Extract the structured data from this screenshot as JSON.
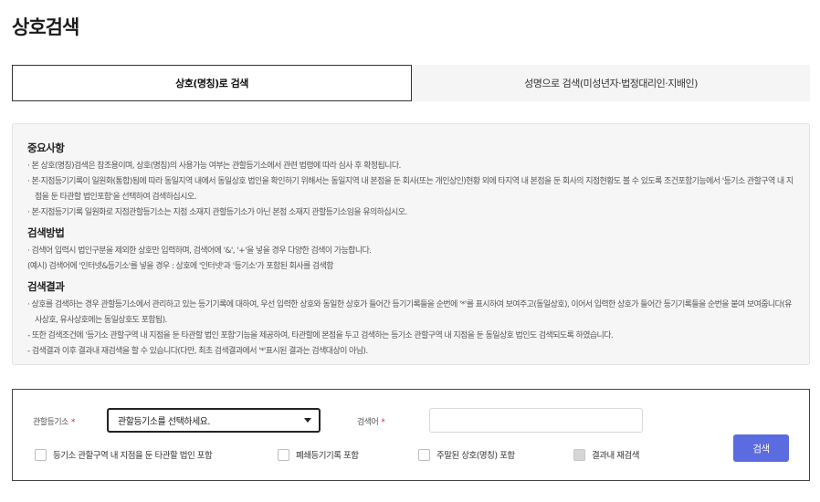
{
  "page": {
    "title": "상호검색"
  },
  "tabs": [
    {
      "label": "상호(명칭)로 검색",
      "active": true
    },
    {
      "label": "성명으로 검색(미성년자·법정대리인·지배인)",
      "active": false
    }
  ],
  "info": {
    "sections": [
      {
        "heading": "중요사항",
        "lines": [
          "· 본 상호(명칭)검색은 참조용이며, 상호(명칭)의 사용가능 여부는 관할등기소에서 관련 법령에 따라 심사 후 확정됩니다.",
          "· 본·지점등기기록이 일원화(통합)됨에 따라 동일지역 내에서 동일상호 법인을 확인하기 위해서는 동일지역 내 본점을 둔 회사(또는 개인상인)현황 외에 타지역 내 본점을 둔 회사의 지점현황도 볼 수 있도록 조건포함기능에서 '등기소 관할구역 내 지점을 둔 타관할 법인포함'을 선택하여 검색하십시오.",
          "· 본·지점등기기록 일원화로 지점관할등기소는 지점 소재지 관할등기소가 아닌 본점 소재지 관할등기소임을 유의하십시오."
        ]
      },
      {
        "heading": "검색방법",
        "lines": [
          "· 검색어 입력시 법인구분을 제외한 상호만 입력하며, 검색어에 '&', '+'을 넣을 경우 다양한 검색이 가능합니다.",
          "  (예시) 검색어에 '인터넷&등기소'를 넣을 경우 : 상호에 '인터넷'과 '등기소'가 포함된 회사를 검색함"
        ]
      },
      {
        "heading": "검색결과",
        "lines": [
          "· 상호를 검색하는 경우 관할등기소에서 관리하고 있는 등기기록에 대하여, 우선 입력한 상호와 동일한 상호가 들어간 등기기록들을 순번에 '*'를 표시하여 보여주고(동일상호), 이어서 입력한 상호가 들어간 등기기록들을 순번을 붙여 보여줍니다(유사상호, 유사상호에는 동일상호도 포함됨).",
          "  - 또한 검색조건에 '등기소 관할구역 내 지점을 둔 타관할 법인 포함'기능을 제공하여, 타관할에 본점을 두고 검색하는 등기소 관할구역 내 지점을 둔 동일상호 법인도 검색되도록 하였습니다.",
          "  - 검색결과 이후 결과내 재검색을 할 수 있습니다(다만, 최초 검색결과에서 '*'표시된 결과는 검색대상이 아님)."
        ]
      }
    ]
  },
  "search": {
    "registry_label": "관할등기소",
    "required_mark": "*",
    "registry_select_value": "관할등기소를 선택하세요.",
    "keyword_label": "검색어",
    "keyword_value": "",
    "keyword_placeholder": "",
    "checkboxes": [
      {
        "label": "등기소 관할구역 내 지점을 둔 타관할 법인 포함",
        "checked": false,
        "disabled": false
      },
      {
        "label": "폐쇄등기기록 포함",
        "checked": false,
        "disabled": false
      },
      {
        "label": "주말된 상호(명칭) 포함",
        "checked": false,
        "disabled": false
      },
      {
        "label": "결과내 재검색",
        "checked": false,
        "disabled": true
      }
    ],
    "search_button_label": "검색",
    "button_color": "#5b6be0"
  }
}
